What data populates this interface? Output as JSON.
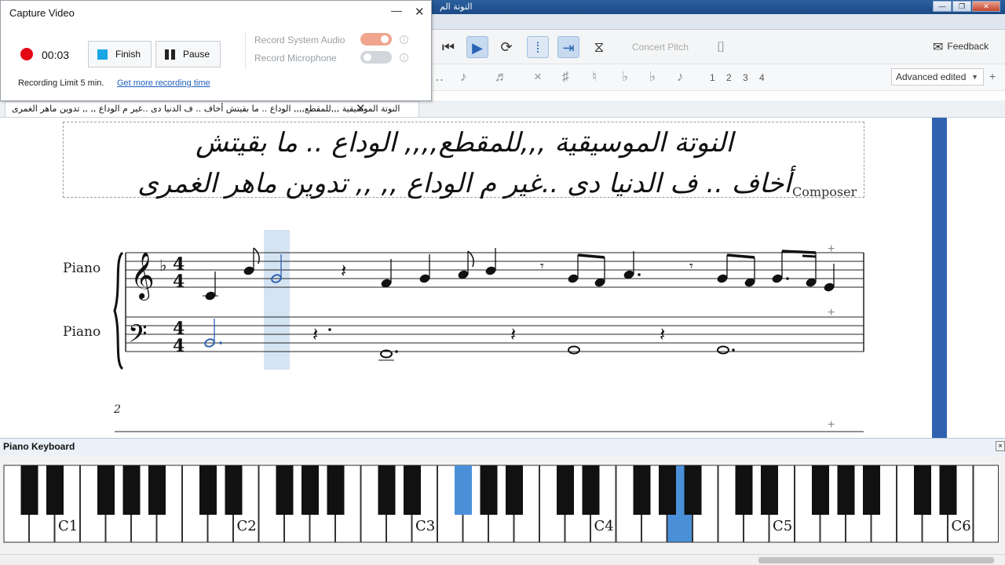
{
  "window": {
    "title_fragment": "النوتة الم",
    "controls": {
      "minimize": "—",
      "restore": "❐",
      "close": "✕"
    }
  },
  "capture": {
    "title": "Capture Video",
    "time": "00:03",
    "finish_label": "Finish",
    "pause_label": "Pause",
    "system_audio_label": "Record System Audio",
    "system_audio_on": true,
    "microphone_label": "Record Microphone",
    "microphone_on": false,
    "limit_text": "Recording Limit 5 min.",
    "more_link": "Get more recording time",
    "colors": {
      "record": "#e30613",
      "finish": "#1aa5e6",
      "toggle_on": "#f0a58f"
    }
  },
  "toolbar": {
    "concert_pitch": "Concert Pitch",
    "feedback": "Feedback",
    "icons": [
      "rewind-icon",
      "play-icon",
      "loop-icon",
      "loop-in-icon",
      "loop-out-icon",
      "metronome-icon",
      "camera-icon"
    ]
  },
  "palette": {
    "voices": [
      "1",
      "2",
      "3",
      "4"
    ],
    "workspace": "Advanced edited",
    "plus": "+"
  },
  "score": {
    "tab_title": "النوتة الموسيقية ,,,للمقطع,,,, الوداع .. ما بقيتش أخاف .. ف الدنيا دى ..غير م الوداع ,, ,, تدوين ماهر الغمرى",
    "title_line1": "النوتة الموسيقية ,,,للمقطع,,,, الوداع .. ما بقيتش",
    "title_line2": "أخاف .. ف الدنيا دى ..غير م الوداع ,, ,, تدوين ماهر الغمرى",
    "composer": "Composer",
    "staff1_name": "Piano",
    "staff2_name": "Piano",
    "time_signature": "4/4",
    "measure_number": "2",
    "accent": "#2f63b0",
    "selection": "#d5e4f3"
  },
  "piano_keyboard": {
    "title": "Piano Keyboard",
    "close": "×",
    "octave_labels": [
      "C1",
      "C2",
      "C3",
      "C4",
      "C5",
      "C6"
    ],
    "highlight": "#4a90d9"
  }
}
